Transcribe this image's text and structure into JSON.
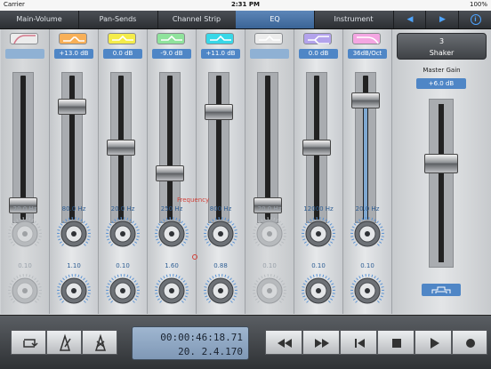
{
  "status_bar": {
    "carrier": "Carrier",
    "time": "2:31 PM",
    "battery": "100%"
  },
  "tabs": [
    {
      "label": "Main-Volume"
    },
    {
      "label": "Pan-Sends"
    },
    {
      "label": "Channel Strip"
    },
    {
      "label": "EQ",
      "active": true
    },
    {
      "label": "Instrument"
    }
  ],
  "nav": {
    "prev": "◀",
    "next": "▶",
    "info": "i"
  },
  "bands": [
    {
      "name": "band-1",
      "icon": "low-cut-icon",
      "color": "#ececec",
      "value": "",
      "freq": "20.0 Hz",
      "q": "0.10",
      "gain_fraction": 0.05,
      "bypassed": true
    },
    {
      "name": "band-2",
      "icon": "high-shelf-icon",
      "color": "#f8b058",
      "value": "+13.0 dB",
      "freq": "80.0 Hz",
      "q": "1.10",
      "gain_fraction": 0.82,
      "bypassed": false
    },
    {
      "name": "band-3",
      "icon": "bell-icon",
      "color": "#f4ec4a",
      "value": "0.0 dB",
      "freq": "20.0 Hz",
      "q": "0.10",
      "gain_fraction": 0.5,
      "bypassed": false
    },
    {
      "name": "band-4",
      "icon": "bell-icon",
      "color": "#8fe39c",
      "value": "-9.0 dB",
      "freq": "250 Hz",
      "q": "1.60",
      "gain_fraction": 0.3,
      "bypassed": false
    },
    {
      "name": "band-5",
      "icon": "bell-icon",
      "color": "#38d8e8",
      "value": "+11.0 dB",
      "freq": "800 Hz",
      "q": "0.88",
      "gain_fraction": 0.78,
      "bypassed": false
    },
    {
      "name": "band-6",
      "icon": "bell-icon",
      "color": "#ececec",
      "value": "",
      "freq": "20.0 Hz",
      "q": "0.10",
      "gain_fraction": 0.05,
      "bypassed": true
    },
    {
      "name": "band-7",
      "icon": "low-shelf-icon",
      "color": "#b3a3ec",
      "value": "0.0 dB",
      "freq": "12000 Hz",
      "q": "0.10",
      "gain_fraction": 0.5,
      "bypassed": false
    },
    {
      "name": "band-8",
      "icon": "high-cut-icon",
      "color": "#f4a6e2",
      "value": "36dB/Oct",
      "freq": "20.0 Hz",
      "q": "0.10",
      "gain_fraction": 0.87,
      "bypassed": false
    }
  ],
  "frequency_label": "Frequency",
  "instrument": {
    "number": "3",
    "name": "Shaker"
  },
  "master": {
    "label": "Master Gain",
    "value": "+6.0 dB"
  },
  "transport": {
    "time": "00:00:46:18.71",
    "position": "20. 2.4.170"
  }
}
